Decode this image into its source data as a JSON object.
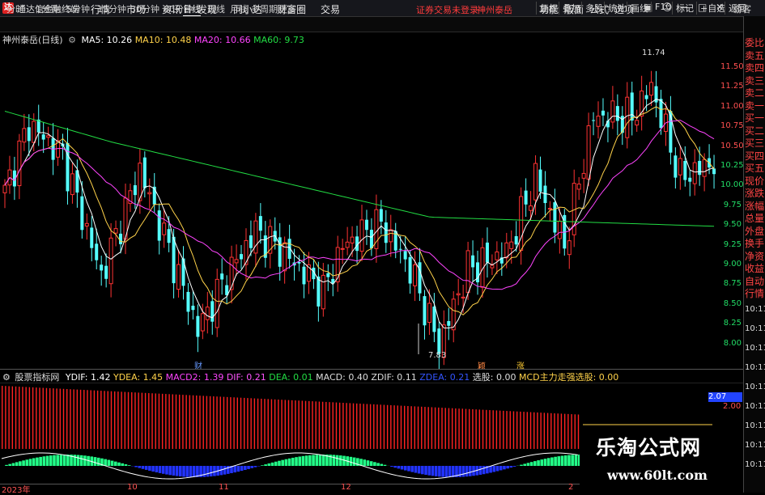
{
  "app": {
    "title": "通达信金融终端",
    "menus": [
      "行情",
      "市场",
      "资讯",
      "发现",
      "问小达",
      "财富圈",
      "交易"
    ],
    "notice": "证券交易未登录",
    "stock_name_red": "神州泰岳",
    "right_menus": [
      "功能",
      "版面",
      "公式",
      "选项"
    ],
    "guest": "游客"
  },
  "periods": [
    "分时",
    "1分钟",
    "5分钟",
    "15分钟",
    "30分钟",
    "60分钟",
    "日线",
    "周线",
    "月线",
    "多周期",
    "更多"
  ],
  "active_period": "日线",
  "tools": [
    "复权",
    "叠加",
    "多股",
    "统计",
    "画线",
    "F10",
    "标记",
    "+自选",
    "返回"
  ],
  "main": {
    "name_label": "神州泰岳(日线)",
    "ma5": "MA5: 10.26",
    "ma10": "MA10: 10.48",
    "ma20": "MA20: 10.66",
    "ma60": "MA60: 9.73",
    "high_label": "11.74",
    "low_label": "7.83",
    "marker_cai": "财",
    "marker_ke": "颖",
    "marker_zhang": "涨",
    "colors": {
      "ma5": "#ffffff",
      "ma10": "#ffd24a",
      "ma20": "#ff44ff",
      "ma60": "#22dd44",
      "up": "#ff3333",
      "down": "#55ffff"
    }
  },
  "y_axis": [
    "11.50",
    "11.25",
    "11.00",
    "10.75",
    "10.50",
    "10.25",
    "10.00",
    "9.75",
    "9.50",
    "9.25",
    "9.00",
    "8.75",
    "8.50",
    "8.25",
    "8.00"
  ],
  "side_panel": [
    "委比",
    "卖五",
    "卖四",
    "卖三",
    "卖二",
    "卖一",
    "买一",
    "买二",
    "买三",
    "买四",
    "买五",
    "现价",
    "涨跌",
    "涨幅",
    "总量",
    "外盘",
    "换手",
    "净资",
    "收益",
    "自动",
    "行情"
  ],
  "side_times": [
    "10:11",
    "10:11",
    "10:11",
    "10:11",
    "10:11",
    "10:11",
    "10:11",
    "10:11",
    "10:11"
  ],
  "macd": {
    "name": "股票指标网",
    "ydif": "YDIF: 1.42",
    "ydea": "YDEA: 1.45",
    "macd2": "MACD2: 1.39",
    "dif": "DIF: 0.21",
    "dea": "DEA: 0.01",
    "macd": "MACD: 0.40",
    "zdif": "ZDIF: 0.11",
    "zdea": "ZDEA: 0.21",
    "xuangu": "选股: 0.00",
    "mcd": "MCD主力走强选股: 0.00",
    "axis_label": "2.07",
    "axis_label2": "2.00"
  },
  "x_axis": [
    "2023年",
    "10",
    "11",
    "12",
    "2"
  ],
  "watermark": {
    "title": "乐淘公式网",
    "url": "www.60lt.com"
  }
}
